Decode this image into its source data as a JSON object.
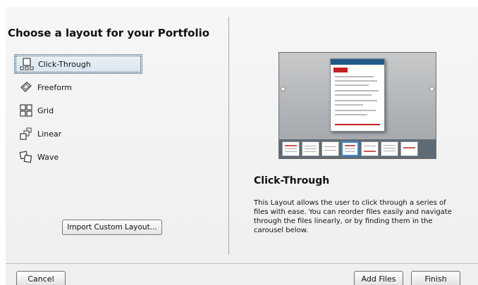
{
  "dialog": {
    "title": "Choose a layout for your Portfolio",
    "layouts": [
      {
        "label": "Click-Through",
        "icon": "click-through-layout-icon",
        "selected": true
      },
      {
        "label": "Freeform",
        "icon": "freeform-layout-icon",
        "selected": false
      },
      {
        "label": "Grid",
        "icon": "grid-layout-icon",
        "selected": false
      },
      {
        "label": "Linear",
        "icon": "linear-layout-icon",
        "selected": false
      },
      {
        "label": "Wave",
        "icon": "wave-layout-icon",
        "selected": false
      }
    ],
    "import_label": "Import Custom Layout...",
    "preview": {
      "heading": "Click-Through",
      "description": "This Layout allows the user to click through a series of files with ease. You can reorder files easily and navigate through the files linearly, or by finding them in the carousel below."
    },
    "footer": {
      "cancel_label": "Cancel",
      "add_files_label": "Add Files",
      "finish_label": "Finish"
    },
    "colors": {
      "selection_border": "#7a98b0",
      "preview_header": "#1f5a8a",
      "preview_accent": "#c42020",
      "carousel_selection": "#3c8ad6"
    }
  }
}
